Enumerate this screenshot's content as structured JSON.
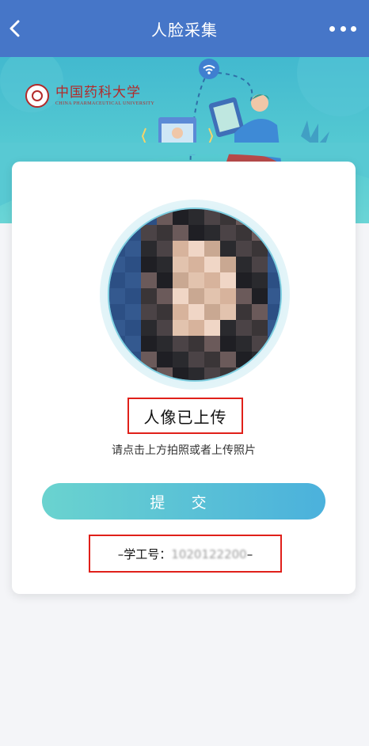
{
  "nav": {
    "title": "人脸采集",
    "back_icon": "chevron-left-icon",
    "more_icon": "more-horizontal-icon"
  },
  "banner": {
    "logo_cn": "中国药科大学",
    "logo_en": "CHINA PHARMACEUTICAL UNIVERSITY",
    "colors": {
      "top": "#42b9cf",
      "bottom": "#6ad5d6"
    }
  },
  "card": {
    "status": "人像已上传",
    "hint": "请点击上方拍照或者上传照片",
    "submit_label": "提 交",
    "id_prefix": "–学工号：",
    "id_value": "1020122200",
    "id_suffix": "–"
  },
  "colors": {
    "nav": "#4676c8",
    "highlight": "#e0201a",
    "button_start": "#6ad3cf",
    "button_end": "#4bb1dc"
  }
}
